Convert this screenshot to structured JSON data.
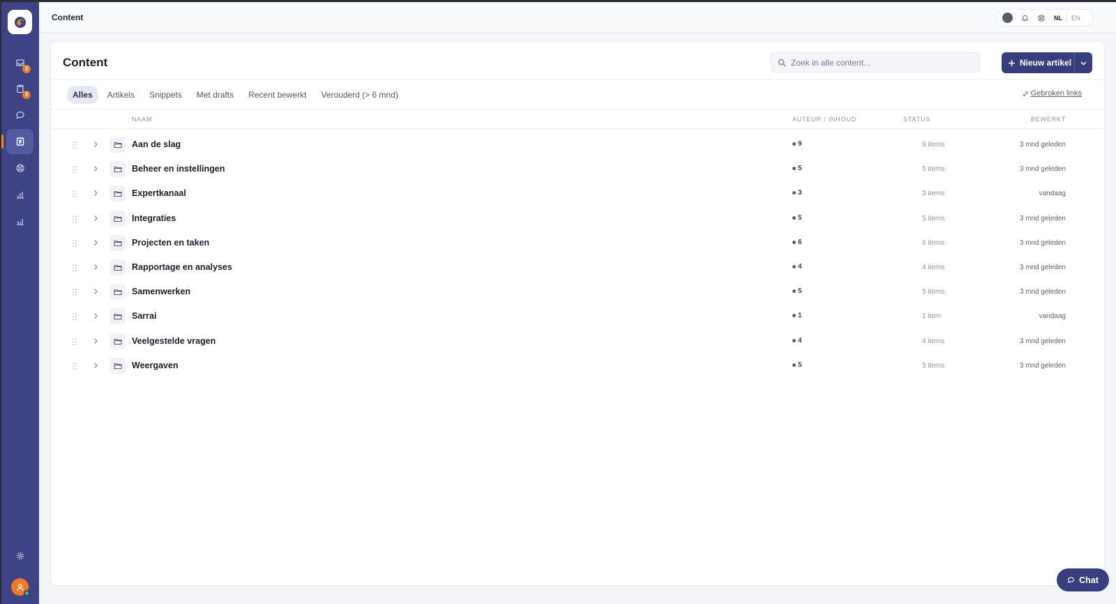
{
  "header": {
    "breadcrumb": "Content",
    "languages": [
      "NL",
      "EN"
    ],
    "active_language": "NL"
  },
  "sidebar": {
    "items": [
      {
        "name": "inbox",
        "icon": "inbox-icon",
        "badge": "3"
      },
      {
        "name": "tasks",
        "icon": "clipboard-icon",
        "badge": "3"
      },
      {
        "name": "chats",
        "icon": "chat-bubble-icon",
        "badge": ""
      },
      {
        "name": "content",
        "icon": "document-icon",
        "badge": "",
        "active": true
      },
      {
        "name": "support",
        "icon": "lifebuoy-icon",
        "badge": ""
      },
      {
        "name": "reports",
        "icon": "bar-chart-icon",
        "badge": ""
      },
      {
        "name": "analytics",
        "icon": "analytics-icon",
        "badge": ""
      }
    ],
    "settings_icon": "gear-icon"
  },
  "main": {
    "title": "Content",
    "search_placeholder": "Zoek in alle content...",
    "new_button_label": "Nieuw artikel",
    "tabs": [
      {
        "label": "Alles",
        "active": true
      },
      {
        "label": "Artikels"
      },
      {
        "label": "Snippets"
      },
      {
        "label": "Met drafts"
      },
      {
        "label": "Recent bewerkt"
      },
      {
        "label": "Verouderd (> 6 mnd)"
      }
    ],
    "broken_links_label": "Gebroken links",
    "columns": {
      "name": "NAAM",
      "author": "AUTEUR / INHOUD",
      "status": "STATUS",
      "edited": "BEWERKT"
    },
    "rows": [
      {
        "name": "Aan de slag",
        "count": "9",
        "status": "9 items",
        "edited": "3 mnd geleden"
      },
      {
        "name": "Beheer en instellingen",
        "count": "5",
        "status": "5 items",
        "edited": "3 mnd geleden"
      },
      {
        "name": "Expertkanaal",
        "count": "3",
        "status": "3 items",
        "edited": "vandaag"
      },
      {
        "name": "Integraties",
        "count": "5",
        "status": "5 items",
        "edited": "3 mnd geleden"
      },
      {
        "name": "Projecten en taken",
        "count": "6",
        "status": "6 items",
        "edited": "3 mnd geleden"
      },
      {
        "name": "Rapportage en analyses",
        "count": "4",
        "status": "4 items",
        "edited": "3 mnd geleden"
      },
      {
        "name": "Samenwerken",
        "count": "5",
        "status": "5 items",
        "edited": "3 mnd geleden"
      },
      {
        "name": "Sarrai",
        "count": "1",
        "status": "1 item",
        "edited": "vandaag"
      },
      {
        "name": "Veelgestelde vragen",
        "count": "4",
        "status": "4 items",
        "edited": "3 mnd geleden"
      },
      {
        "name": "Weergaven",
        "count": "5",
        "status": "5 items",
        "edited": "3 mnd geleden"
      }
    ]
  },
  "chat": {
    "label": "Chat"
  },
  "colors": {
    "sidebar": "#3d4384",
    "primary_button": "#383d7d",
    "accent": "#f08a24",
    "badge": "#e8782a",
    "presence": "#34c26a"
  }
}
